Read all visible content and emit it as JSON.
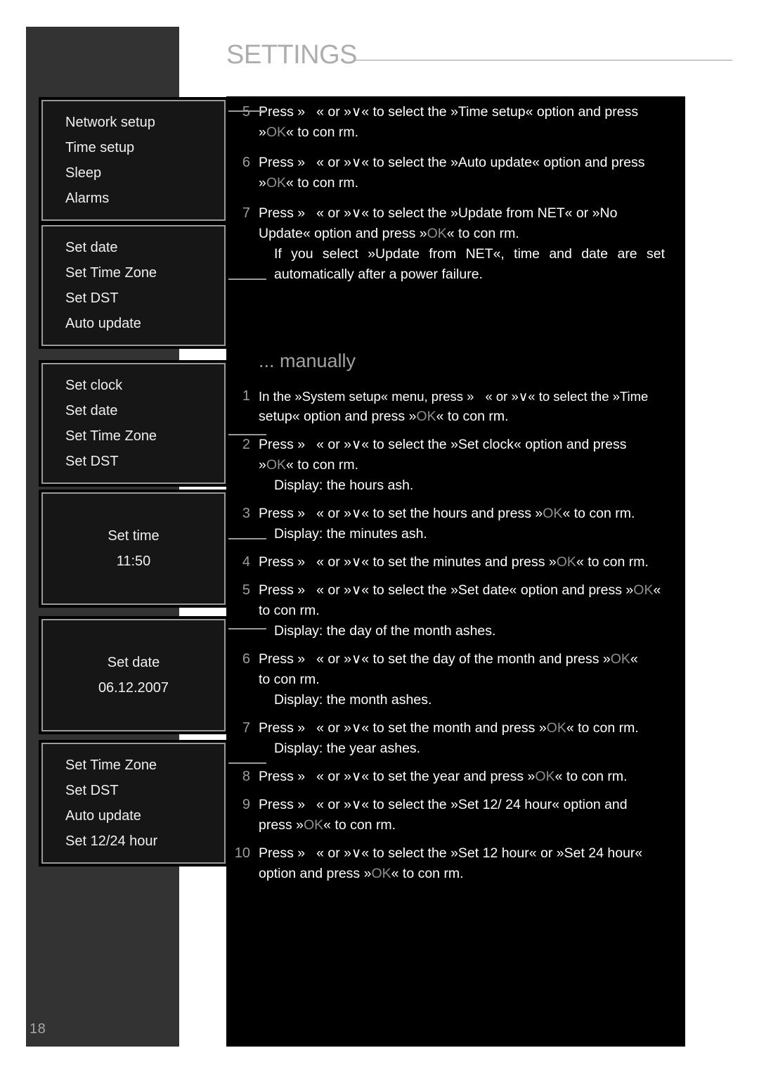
{
  "header": {
    "title": "SETTINGS",
    "page_number": "18"
  },
  "colors": {
    "page_background": "#ffffff",
    "left_column": "#333333",
    "content_panel": "#000000",
    "heading_gray": "#adadad",
    "screen_border": "#9a9a9a",
    "screen_fill": "#161616",
    "ok_gray": "#8f8f8f",
    "step_number_gray": "#9d9d9d"
  },
  "device_screens": [
    {
      "name": "system-setup-menu",
      "layout": "list",
      "rows": [
        "Network setup",
        "Time setup",
        "Sleep",
        "Alarms"
      ]
    },
    {
      "name": "time-setup-menu",
      "layout": "list",
      "rows": [
        "Set date",
        "Set Time Zone",
        "Set DST",
        "Auto update"
      ]
    },
    {
      "name": "clock-menu",
      "layout": "list",
      "rows": [
        "Set clock",
        "Set date",
        "Set Time Zone",
        "Set DST"
      ]
    },
    {
      "name": "set-time-screen",
      "layout": "centered",
      "rows": [
        "Set time",
        "11:50"
      ]
    },
    {
      "name": "set-date-screen",
      "layout": "centered",
      "rows": [
        "Set date",
        "06.12.2007"
      ]
    },
    {
      "name": "time-zone-menu",
      "layout": "list",
      "rows": [
        "Set Time Zone",
        "Set DST",
        "Auto update",
        "Set 12/24 hour"
      ]
    }
  ],
  "instructions_top": [
    {
      "num": "5",
      "lines": [
        "Press »",
        "« or »∨« to select the »Time setup« option and press"
      ],
      "line2_pre": "»",
      "line2_ok": "OK",
      "line2_post": "« to con rm."
    },
    {
      "num": "6",
      "lines": [
        "Press »",
        "« or »∨« to select the »Auto update« option and press"
      ],
      "line2_pre": "»",
      "line2_ok": "OK",
      "line2_post": "« to con rm."
    },
    {
      "num": "7",
      "lines": [
        "Press »",
        "« or »∨« to select the »Update from NET« or »No"
      ],
      "line2_pre": "Update« option and press »",
      "line2_ok": "OK",
      "line2_post": "« to con rm.",
      "note": "If you select »Update from NET«, time and date are set automatically after a power failure."
    }
  ],
  "section": {
    "heading": "... manually"
  },
  "instructions_manual": [
    {
      "num": "1",
      "line1_a": "In the »System setup« menu, press »",
      "line1_b": "« or »∨« to select the »Time",
      "line2_pre": "setup« option and press »",
      "line2_ok": "OK",
      "line2_post": "« to con rm."
    },
    {
      "num": "2",
      "line1_a": "Press »",
      "line1_b": "« or »∨« to select the »Set clock« option and press",
      "line2_pre": "»",
      "line2_ok": "OK",
      "line2_post": "« to con rm.",
      "note": "Display: the hours  ash."
    },
    {
      "num": "3",
      "line1_a": "Press »",
      "line1_b": "« or »∨« to set the hours and press »",
      "line1_ok": "OK",
      "line1_c": "« to con rm.",
      "note": "Display: the minutes  ash."
    },
    {
      "num": "4",
      "line1_a": "Press »",
      "line1_b": "« or »∨« to set the minutes and press »",
      "line1_ok": "OK",
      "line1_c": "« to con rm."
    },
    {
      "num": "5",
      "line1_a": "Press »",
      "line1_b": "« or »∨« to select the »Set date« option and press »",
      "line1_ok": "OK",
      "line1_c": "«",
      "line2_post": "to con rm.",
      "note": "Display: the day of the month  ashes."
    },
    {
      "num": "6",
      "line1_a": "Press »",
      "line1_b": "« or »∨« to set the day of the month and press »",
      "line1_ok": "OK",
      "line1_c": "«",
      "line2_post": "to con rm.",
      "note": "Display: the month  ashes."
    },
    {
      "num": "7",
      "line1_a": "Press »",
      "line1_b": "« or »∨« to set the month and press »",
      "line1_ok": "OK",
      "line1_c": "« to con rm.",
      "note": "Display: the year  ashes."
    },
    {
      "num": "8",
      "line1_a": "Press »",
      "line1_b": "« or »∨« to set the year and press »",
      "line1_ok": "OK",
      "line1_c": "« to con rm."
    },
    {
      "num": "9",
      "line1_a": "Press »",
      "line1_b": "« or »∨« to select the »Set 12/ 24 hour« option and",
      "line2_pre": "press »",
      "line2_ok": "OK",
      "line2_post": "« to con rm."
    },
    {
      "num": "10",
      "line1_a": "Press »",
      "line1_b": "« or »∨« to select the »Set 12 hour« or »Set 24 hour«",
      "line2_pre": "option and press »",
      "line2_ok": "OK",
      "line2_post": "« to con rm."
    }
  ]
}
